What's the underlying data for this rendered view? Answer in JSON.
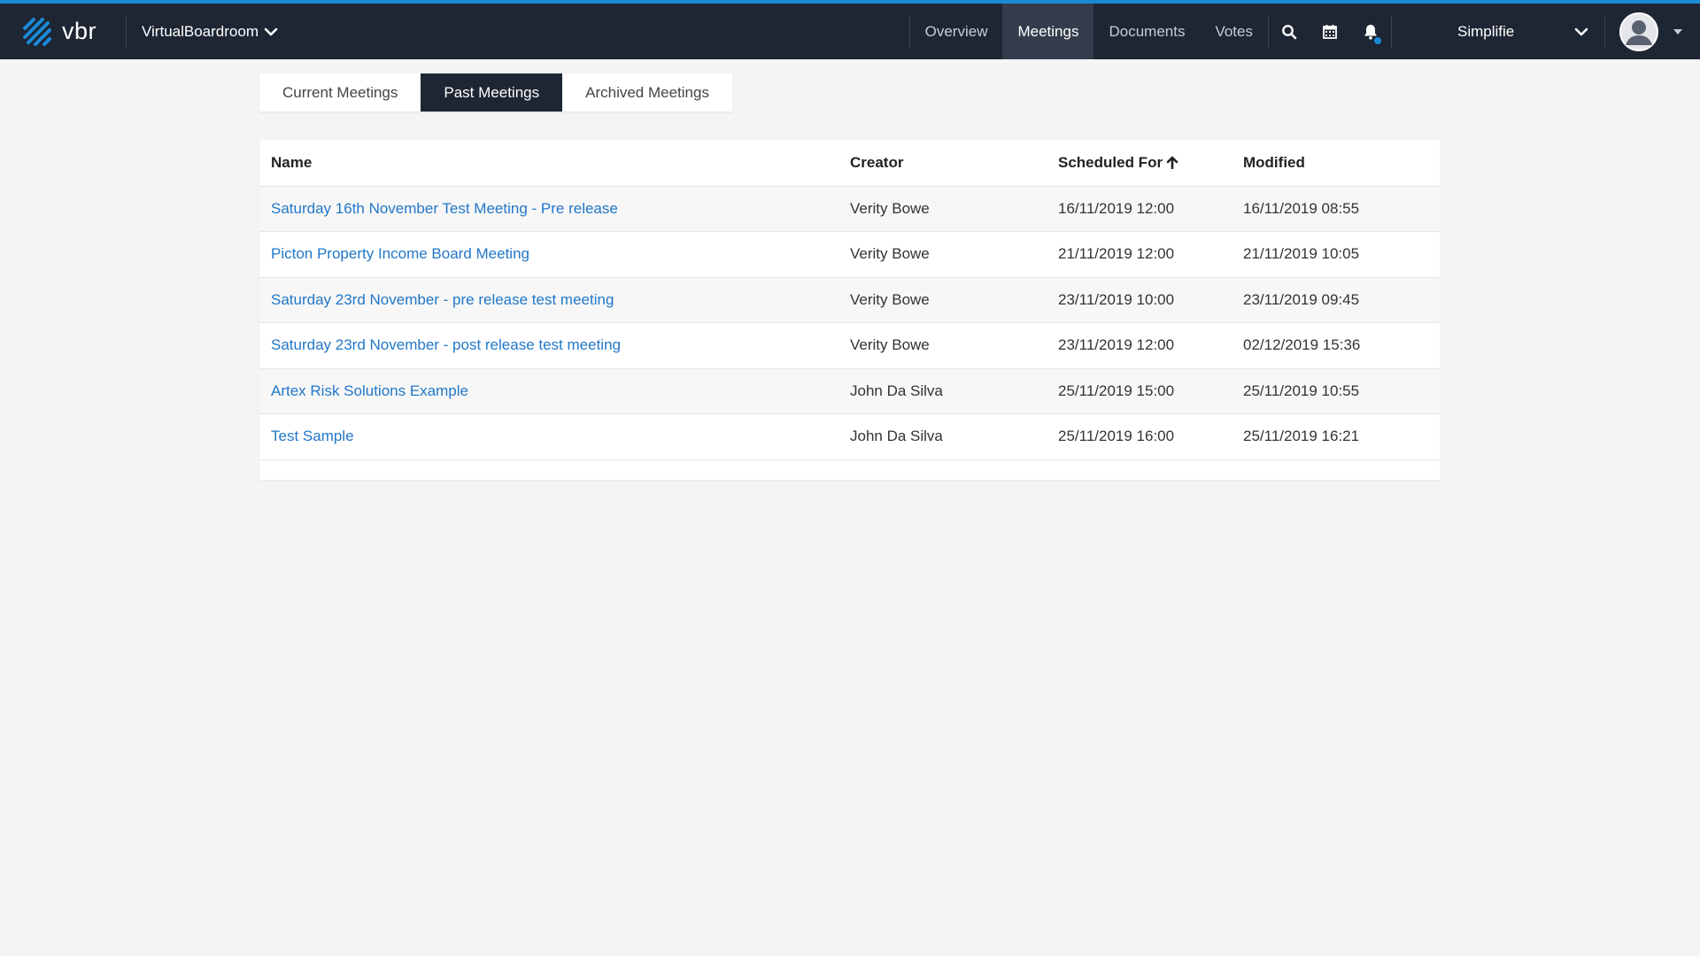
{
  "brand": {
    "name": "vbr"
  },
  "org_switcher": {
    "label": "VirtualBoardroom"
  },
  "nav": {
    "items": [
      {
        "label": "Overview",
        "active": false
      },
      {
        "label": "Meetings",
        "active": true
      },
      {
        "label": "Documents",
        "active": false
      },
      {
        "label": "Votes",
        "active": false
      }
    ]
  },
  "header_icons": [
    "search-icon",
    "calendar-icon",
    "bell-icon"
  ],
  "user_org": {
    "label": "Simplifie"
  },
  "colors": {
    "topbar": "#1e2533",
    "accent": "#1a8ad6",
    "link": "#2277c9"
  },
  "tabs": [
    {
      "label": "Current Meetings",
      "active": false
    },
    {
      "label": "Past Meetings",
      "active": true
    },
    {
      "label": "Archived Meetings",
      "active": false
    }
  ],
  "table": {
    "headers": {
      "name": "Name",
      "creator": "Creator",
      "scheduled": "Scheduled For",
      "modified": "Modified"
    },
    "sort_column": "scheduled",
    "sort_direction": "ascending",
    "rows": [
      {
        "name": "Saturday 16th November Test Meeting - Pre release",
        "creator": "Verity Bowe",
        "scheduled": "16/11/2019 12:00",
        "modified": "16/11/2019 08:55"
      },
      {
        "name": "Picton Property Income Board Meeting",
        "creator": "Verity Bowe",
        "scheduled": "21/11/2019 12:00",
        "modified": "21/11/2019 10:05"
      },
      {
        "name": "Saturday 23rd November - pre release test meeting",
        "creator": "Verity Bowe",
        "scheduled": "23/11/2019 10:00",
        "modified": "23/11/2019 09:45"
      },
      {
        "name": "Saturday 23rd November - post release test meeting",
        "creator": "Verity Bowe",
        "scheduled": "23/11/2019 12:00",
        "modified": "02/12/2019 15:36"
      },
      {
        "name": "Artex Risk Solutions Example",
        "creator": "John Da Silva",
        "scheduled": "25/11/2019 15:00",
        "modified": "25/11/2019 10:55"
      },
      {
        "name": "Test Sample",
        "creator": "John Da Silva",
        "scheduled": "25/11/2019 16:00",
        "modified": "25/11/2019 16:21"
      }
    ]
  }
}
